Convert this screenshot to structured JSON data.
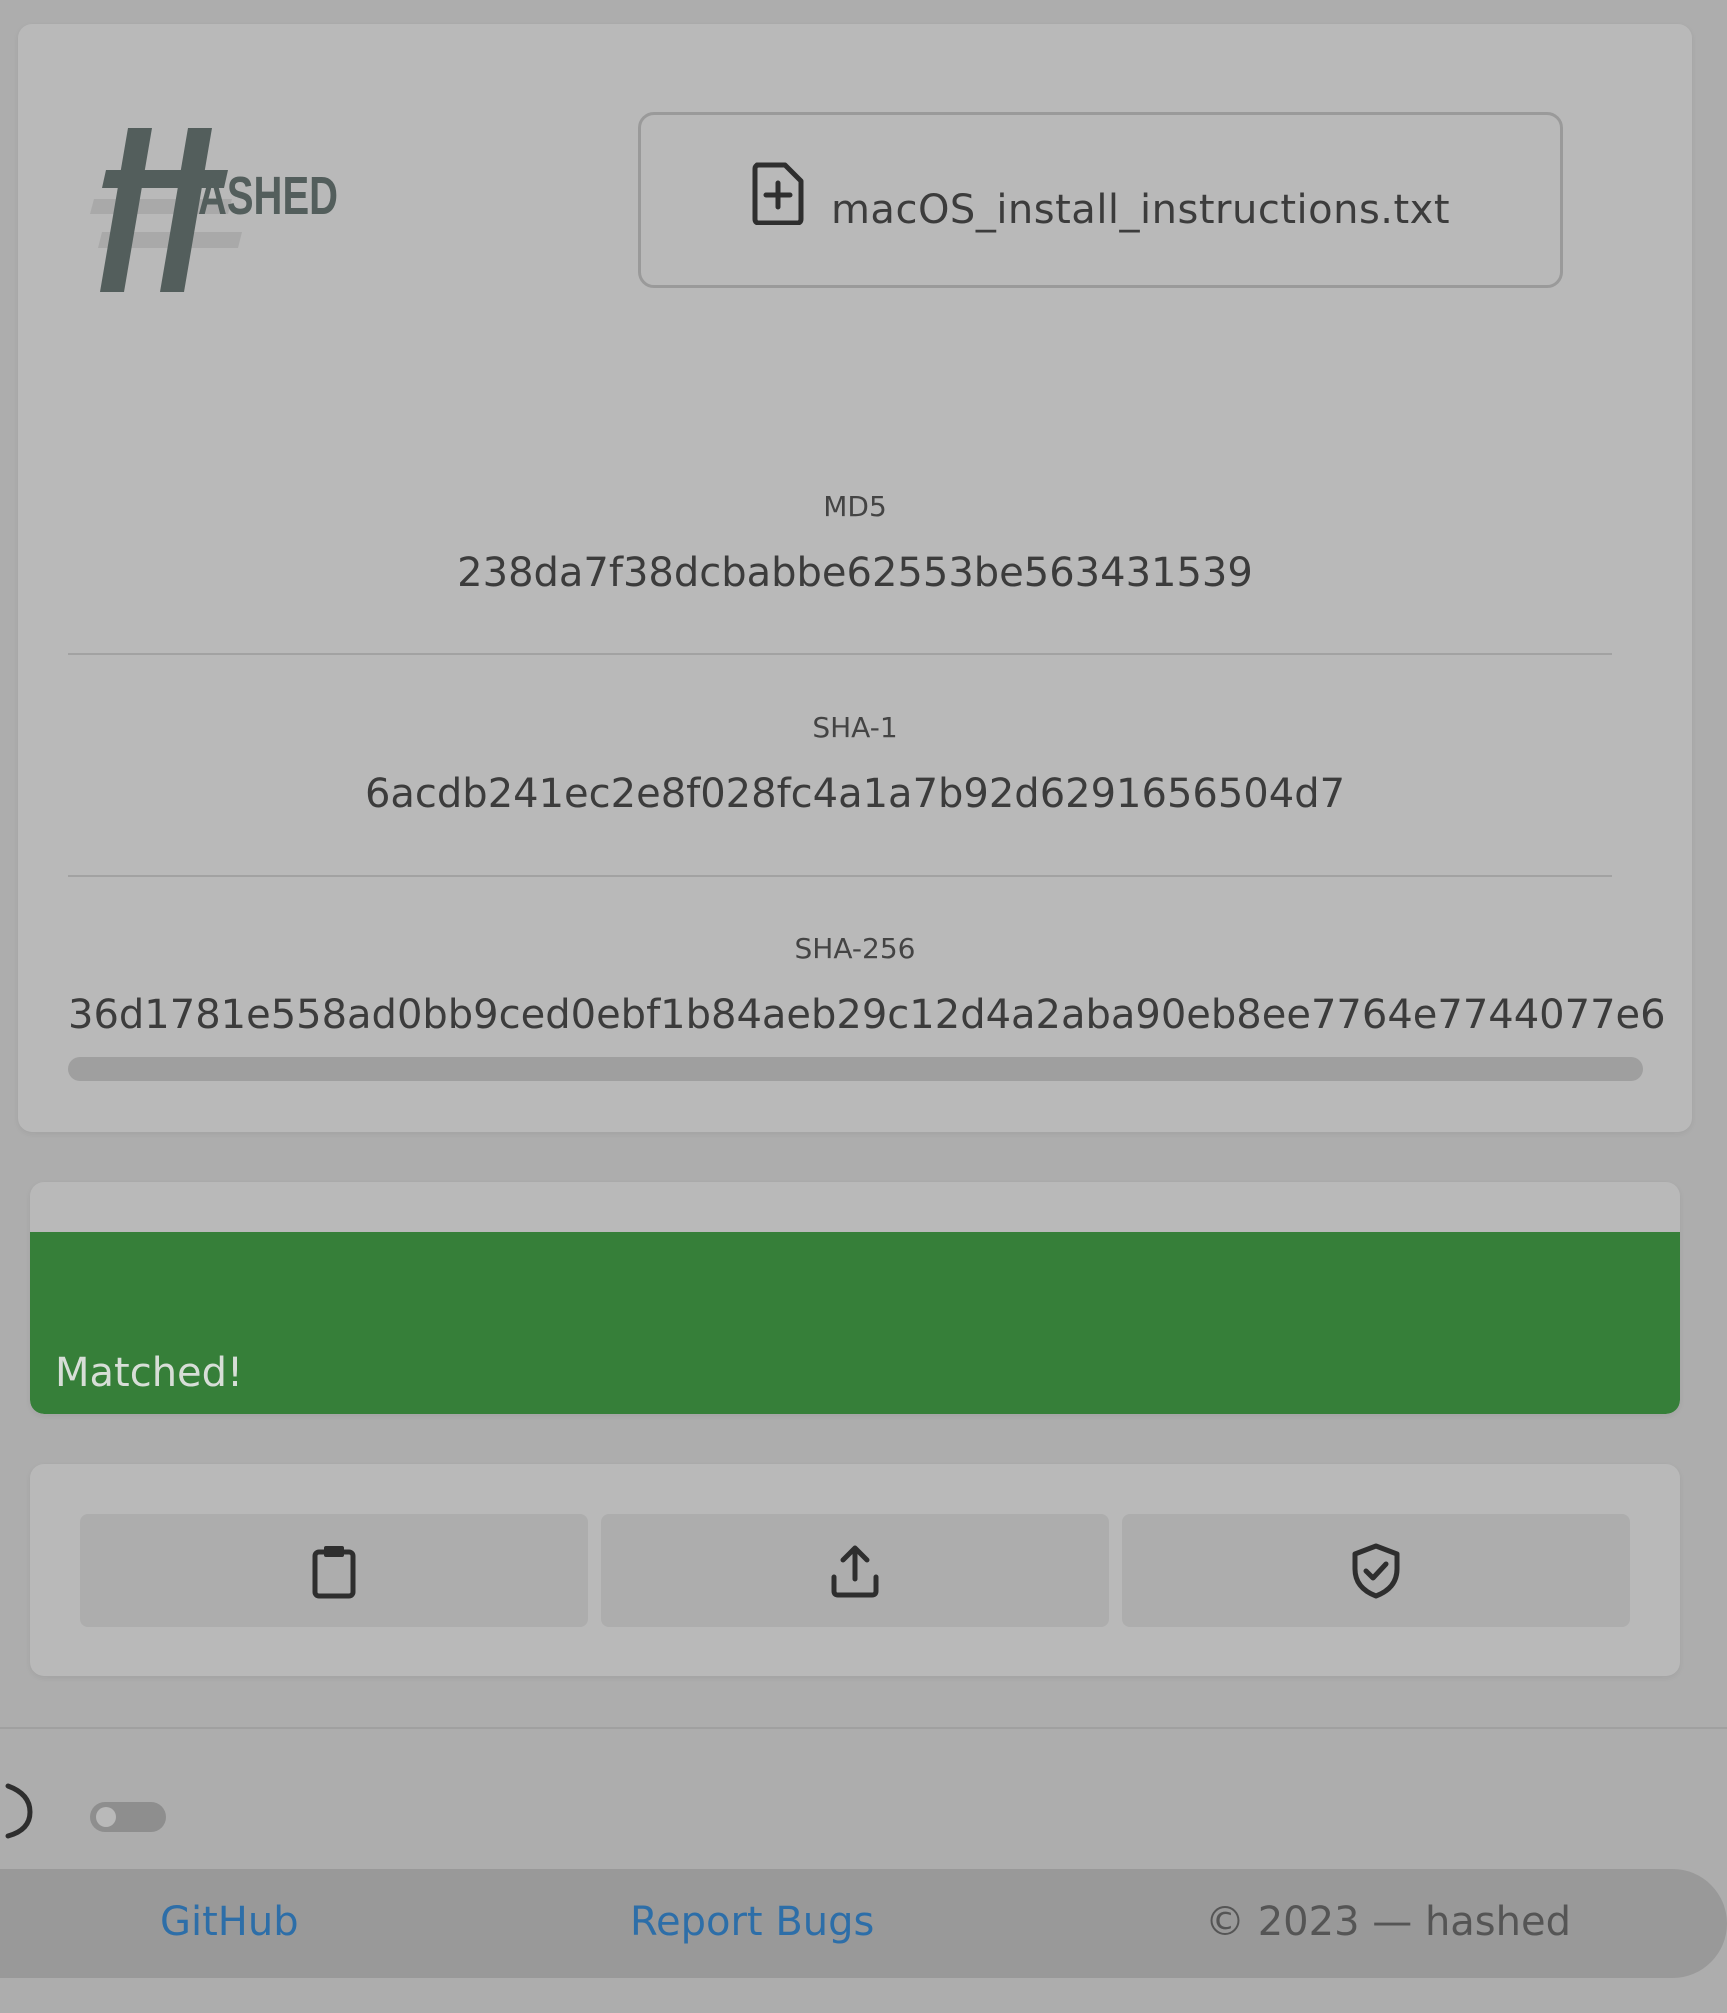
{
  "app": {
    "logo_text": "ASHED"
  },
  "file": {
    "name": "macOS_install_instructions.txt"
  },
  "hashes": {
    "md5": {
      "label": "MD5",
      "value": "238da7f38dcbabbe62553be563431539"
    },
    "sha1": {
      "label": "SHA-1",
      "value": "6acdb241ec2e8f028fc4a1a7b92d6291656504d7"
    },
    "sha256": {
      "label": "SHA-256",
      "value": "36d1781e558ad0bb9ced0ebf1b84aeb29c12d4a2aba90eb8ee7764e7744077e6"
    }
  },
  "match": {
    "text": "Matched!"
  },
  "actions": {
    "copy": "clipboard-icon",
    "share": "upload-icon",
    "verify": "shield-check-icon"
  },
  "theme": {
    "dark_mode": false
  },
  "footer": {
    "github": "GitHub",
    "report_bugs": "Report Bugs",
    "copyright": "© 2023 — hashed"
  },
  "colors": {
    "background": "#adadad",
    "card": "#b9b9b9",
    "match_green": "#367f39",
    "link_blue": "#2d6ea8",
    "logo": "#535e5c"
  }
}
